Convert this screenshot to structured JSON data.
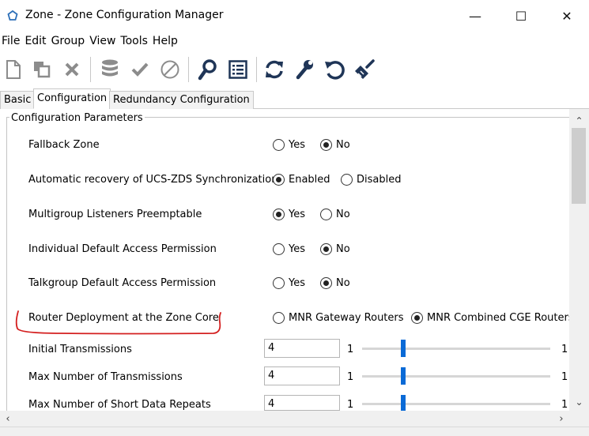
{
  "window": {
    "title": "Zone - Zone Configuration Manager",
    "minimize_glyph": "—",
    "maximize_glyph": "☐",
    "close_glyph": "✕"
  },
  "menu": [
    "File",
    "Edit",
    "Group",
    "View",
    "Tools",
    "Help"
  ],
  "toolbar": [
    {
      "icon": "new-document-icon",
      "enabled": false
    },
    {
      "icon": "copy-icon",
      "enabled": false
    },
    {
      "icon": "delete-icon",
      "enabled": false
    },
    {
      "icon": "database-icon",
      "enabled": false
    },
    {
      "icon": "checkmark-icon",
      "enabled": false
    },
    {
      "icon": "cancel-icon",
      "enabled": false
    },
    {
      "icon": "search-icon",
      "enabled": true
    },
    {
      "icon": "list-view-icon",
      "enabled": true
    },
    {
      "icon": "refresh-icon",
      "enabled": true
    },
    {
      "icon": "wrench-icon",
      "enabled": true
    },
    {
      "icon": "undo-icon",
      "enabled": true
    },
    {
      "icon": "broom-icon",
      "enabled": true
    }
  ],
  "tabs": [
    {
      "label": "Basic",
      "active": false
    },
    {
      "label": "Configuration",
      "active": true
    },
    {
      "label": "Redundancy Configuration",
      "active": false
    }
  ],
  "group_title": "Configuration Parameters",
  "parameters": [
    {
      "label": "Fallback Zone",
      "options": [
        "Yes",
        "No"
      ],
      "selected": 1
    },
    {
      "label": "Automatic recovery of UCS-ZDS Synchronization",
      "options": [
        "Enabled",
        "Disabled"
      ],
      "selected": 0
    },
    {
      "label": "Multigroup Listeners Preemptable",
      "options": [
        "Yes",
        "No"
      ],
      "selected": 0
    },
    {
      "label": "Individual Default Access Permission",
      "options": [
        "Yes",
        "No"
      ],
      "selected": 1
    },
    {
      "label": "Talkgroup Default Access Permission",
      "options": [
        "Yes",
        "No"
      ],
      "selected": 1
    },
    {
      "label": "Router Deployment at the Zone Core",
      "options": [
        "MNR Gateway Routers",
        "MNR Combined CGE Routers"
      ],
      "selected": 1
    }
  ],
  "numeric_params": [
    {
      "label": "Initial Transmissions",
      "value": "4",
      "min": "1",
      "max": "1",
      "slider_fraction": 0.21
    },
    {
      "label": "Max Number of Transmissions",
      "value": "4",
      "min": "1",
      "max": "1",
      "slider_fraction": 0.21
    },
    {
      "label": "Max Number of Short Data Repeats",
      "value": "4",
      "min": "1",
      "max": "1",
      "slider_fraction": 0.21
    }
  ],
  "colors": {
    "accent": "#0a6ad6",
    "title_icon": "#2c6fb8",
    "annotation": "#d42020",
    "enabled_icon": "#1f3557",
    "disabled_icon": "#8c8c8c"
  }
}
